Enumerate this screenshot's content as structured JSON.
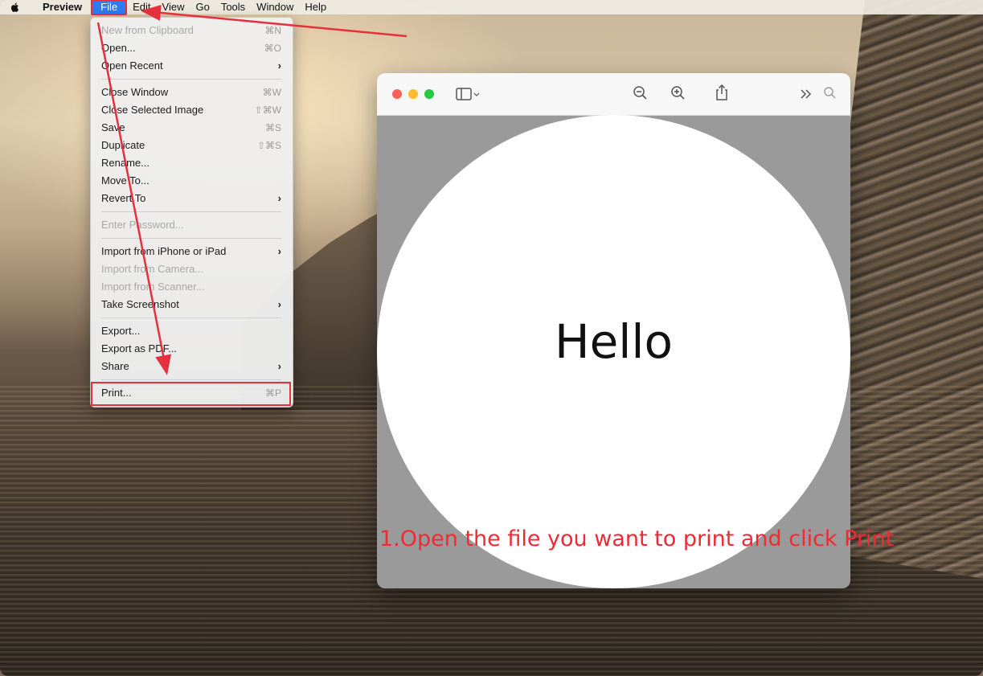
{
  "menubar": {
    "app": "Preview",
    "items": [
      "File",
      "Edit",
      "View",
      "Go",
      "Tools",
      "Window",
      "Help"
    ]
  },
  "file_menu": {
    "items": [
      {
        "label": "New from Clipboard",
        "shortcut": "⌘N",
        "disabled": true
      },
      {
        "label": "Open...",
        "shortcut": "⌘O"
      },
      {
        "label": "Open Recent",
        "submenu": true
      },
      {
        "label": "Close Window",
        "shortcut": "⌘W"
      },
      {
        "label": "Close Selected Image",
        "shortcut": "⇧⌘W"
      },
      {
        "label": "Save",
        "shortcut": "⌘S"
      },
      {
        "label": "Duplicate",
        "shortcut": "⇧⌘S"
      },
      {
        "label": "Rename..."
      },
      {
        "label": "Move To..."
      },
      {
        "label": "Revert To",
        "submenu": true
      },
      {
        "label": "Enter Password...",
        "disabled": true
      },
      {
        "label": "Import from iPhone or iPad",
        "submenu": true
      },
      {
        "label": "Import from Camera...",
        "disabled": true
      },
      {
        "label": "Import from Scanner...",
        "disabled": true
      },
      {
        "label": "Take Screenshot",
        "submenu": true
      },
      {
        "label": "Export..."
      },
      {
        "label": "Export as PDF..."
      },
      {
        "label": "Share",
        "submenu": true
      },
      {
        "label": "Print...",
        "shortcut": "⌘P"
      }
    ]
  },
  "preview": {
    "document_text": "Hello"
  },
  "annotation": {
    "instruction": "1.Open the file you want to print and click Print"
  },
  "colors": {
    "annotation_red": "#e5303d",
    "menu_highlight": "#2f7bf6"
  },
  "icons": [
    "apple-logo-icon",
    "sidebar-toggle-icon",
    "zoom-out-icon",
    "zoom-in-icon",
    "share-icon",
    "more-chevron-icon",
    "search-icon"
  ]
}
